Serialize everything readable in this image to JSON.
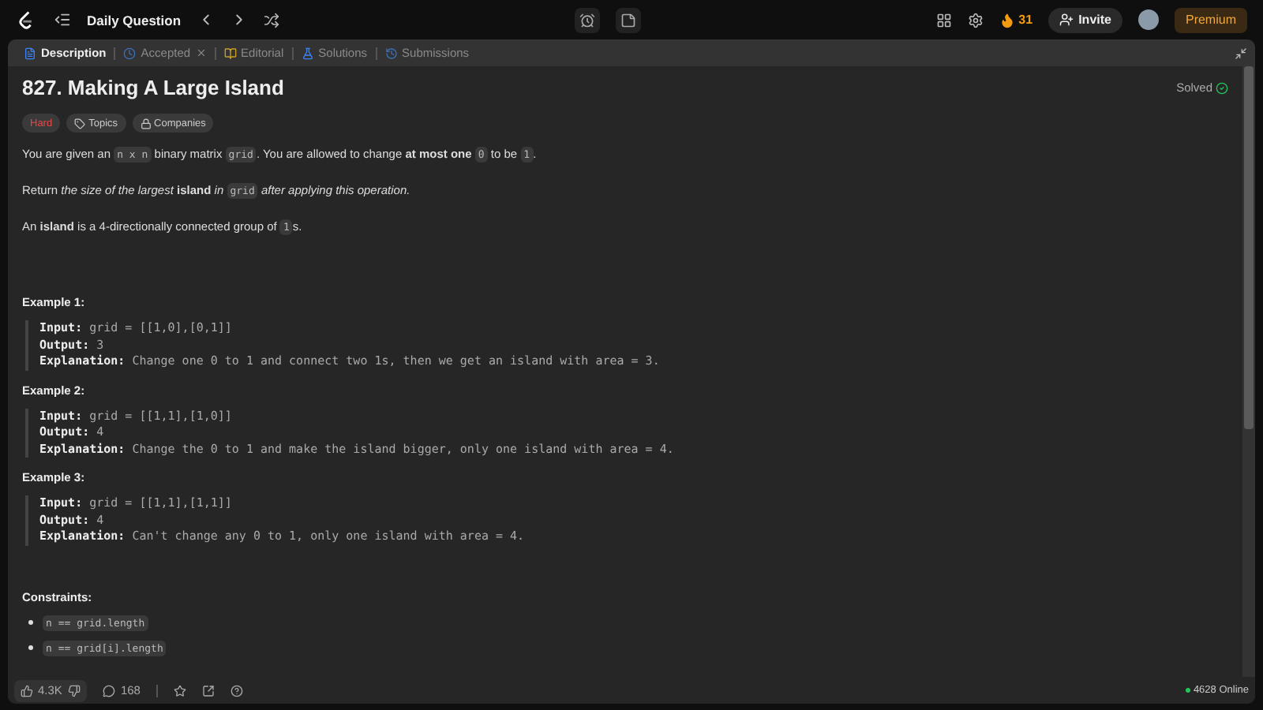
{
  "topbar": {
    "title": "Daily Question",
    "streak": "31",
    "invite": "Invite",
    "premium": "Premium"
  },
  "tabs": [
    {
      "label": "Description",
      "selected": true,
      "closable": false,
      "color": "#3b82f6"
    },
    {
      "label": "Accepted",
      "selected": false,
      "closable": true,
      "color": "#3b6fb6"
    },
    {
      "label": "Editorial",
      "selected": false,
      "closable": false,
      "color": "#c9a227"
    },
    {
      "label": "Solutions",
      "selected": false,
      "closable": false,
      "color": "#3b82f6"
    },
    {
      "label": "Submissions",
      "selected": false,
      "closable": false,
      "color": "#3b6fb6"
    }
  ],
  "problem": {
    "title": "827. Making A Large Island",
    "status": "Solved",
    "difficulty": "Hard",
    "tags": [
      {
        "kind": "tag",
        "label": "Topics"
      },
      {
        "kind": "lock",
        "label": "Companies"
      }
    ]
  },
  "paragraphs": [
    [
      {
        "kind": "text",
        "text": "You are given an "
      },
      {
        "kind": "code",
        "text": "n x n"
      },
      {
        "kind": "text",
        "text": " binary matrix "
      },
      {
        "kind": "code",
        "text": "grid"
      },
      {
        "kind": "text",
        "text": ". You are allowed to change **at most one** "
      },
      {
        "kind": "code",
        "text": "0"
      },
      {
        "kind": "text",
        "text": " to be "
      },
      {
        "kind": "code",
        "text": "1"
      },
      {
        "kind": "text",
        "text": "."
      }
    ],
    [
      {
        "kind": "text",
        "text": "Return *the size of the largest* **island** *in* "
      },
      {
        "kind": "code",
        "text": "grid"
      },
      {
        "kind": "text",
        "text": " *after applying this operation.*"
      }
    ],
    [
      {
        "kind": "text",
        "text": "An **island** is a 4-directionally connected group of "
      },
      {
        "kind": "code",
        "text": "1"
      },
      {
        "kind": "text",
        "text": "s."
      }
    ]
  ],
  "examples": [
    {
      "title": "Example 1:",
      "lines": [
        {
          "label": "Input:",
          "value": "grid = [[1,0],[0,1]]"
        },
        {
          "label": "Output:",
          "value": "3"
        },
        {
          "label": "Explanation:",
          "value": "Change one 0 to 1 and connect two 1s, then we get an island with area = 3."
        }
      ]
    },
    {
      "title": "Example 2:",
      "lines": [
        {
          "label": "Input:",
          "value": "grid = [[1,1],[1,0]]"
        },
        {
          "label": "Output:",
          "value": "4"
        },
        {
          "label": "Explanation:",
          "value": "Change the 0 to 1 and make the island bigger, only one island with area = 4."
        }
      ]
    },
    {
      "title": "Example 3:",
      "lines": [
        {
          "label": "Input:",
          "value": "grid = [[1,1],[1,1]]"
        },
        {
          "label": "Output:",
          "value": "4"
        },
        {
          "label": "Explanation:",
          "value": "Can't change any 0 to 1, only one island with area = 4."
        }
      ]
    }
  ],
  "constraints": {
    "title": "Constraints:",
    "items": [
      "n == grid.length",
      "n == grid[i].length"
    ]
  },
  "footer": {
    "likes": "4.3K",
    "comments": "168",
    "online": "4628 Online"
  }
}
